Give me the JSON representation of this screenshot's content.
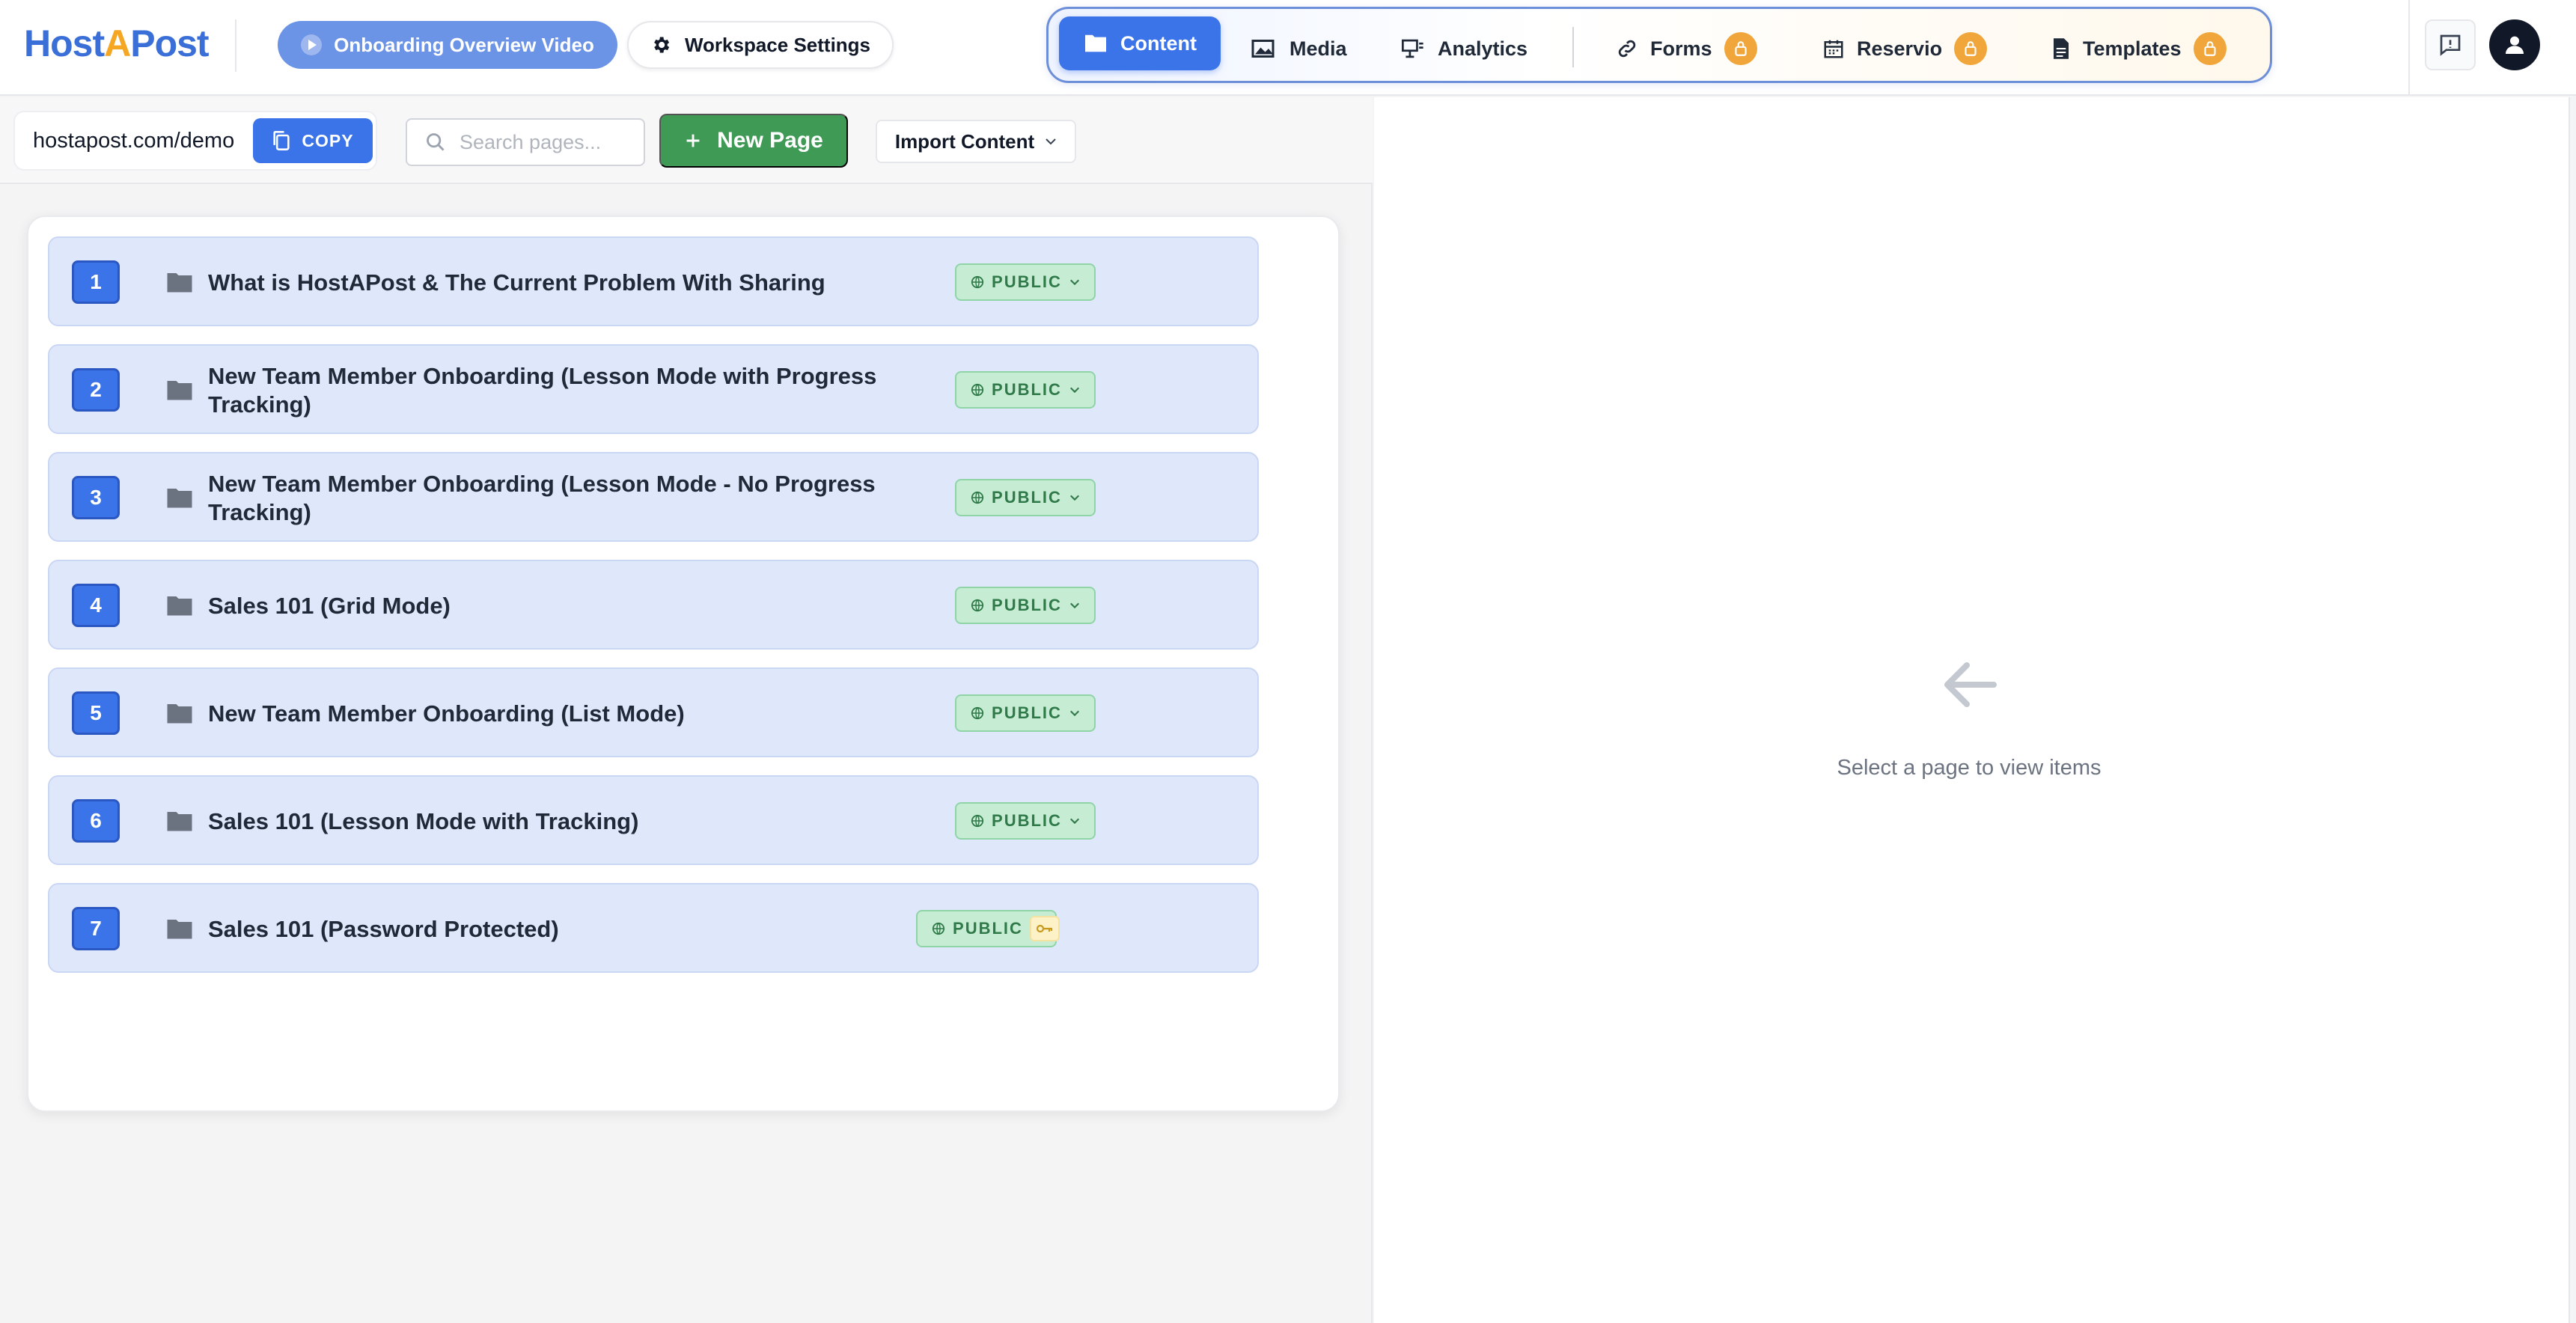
{
  "header": {
    "logo": {
      "part1": "Host",
      "part2": "A",
      "part3": "Post"
    },
    "video_button": "Onboarding Overview Video",
    "workspace_button": "Workspace Settings",
    "nav": [
      {
        "label": "Content",
        "icon": "folder-icon",
        "active": true,
        "locked": false
      },
      {
        "label": "Media",
        "icon": "image-icon",
        "active": false,
        "locked": false
      },
      {
        "label": "Analytics",
        "icon": "analytics-icon",
        "active": false,
        "locked": false
      },
      {
        "label": "Forms",
        "icon": "link-icon",
        "active": false,
        "locked": true
      },
      {
        "label": "Reservio",
        "icon": "calendar-icon",
        "active": false,
        "locked": true
      },
      {
        "label": "Templates",
        "icon": "document-icon",
        "active": false,
        "locked": true
      }
    ]
  },
  "toolbar": {
    "url": "hostapost.com/demo",
    "copy_label": "COPY",
    "search_placeholder": "Search pages...",
    "new_page_label": "New Page",
    "import_label": "Import Content"
  },
  "pages": [
    {
      "num": "1",
      "title": "What is HostAPost & The Current Problem With Sharing",
      "visibility": "PUBLIC",
      "password": false
    },
    {
      "num": "2",
      "title": "New Team Member Onboarding (Lesson Mode with Progress Tracking)",
      "visibility": "PUBLIC",
      "password": false
    },
    {
      "num": "3",
      "title": "New Team Member Onboarding (Lesson Mode - No Progress Tracking)",
      "visibility": "PUBLIC",
      "password": false
    },
    {
      "num": "4",
      "title": "Sales 101 (Grid Mode)",
      "visibility": "PUBLIC",
      "password": false
    },
    {
      "num": "5",
      "title": "New Team Member Onboarding (List Mode)",
      "visibility": "PUBLIC",
      "password": false
    },
    {
      "num": "6",
      "title": "Sales 101 (Lesson Mode with Tracking)",
      "visibility": "PUBLIC",
      "password": false
    },
    {
      "num": "7",
      "title": "Sales 101 (Password Protected)",
      "visibility": "PUBLIC",
      "password": true
    }
  ],
  "empty_state": {
    "text": "Select a page to view items"
  },
  "colors": {
    "accent": "#3b73e8",
    "success": "#3f9a55",
    "lock": "#f0a63a",
    "public_badge": "#c6ecd3"
  }
}
